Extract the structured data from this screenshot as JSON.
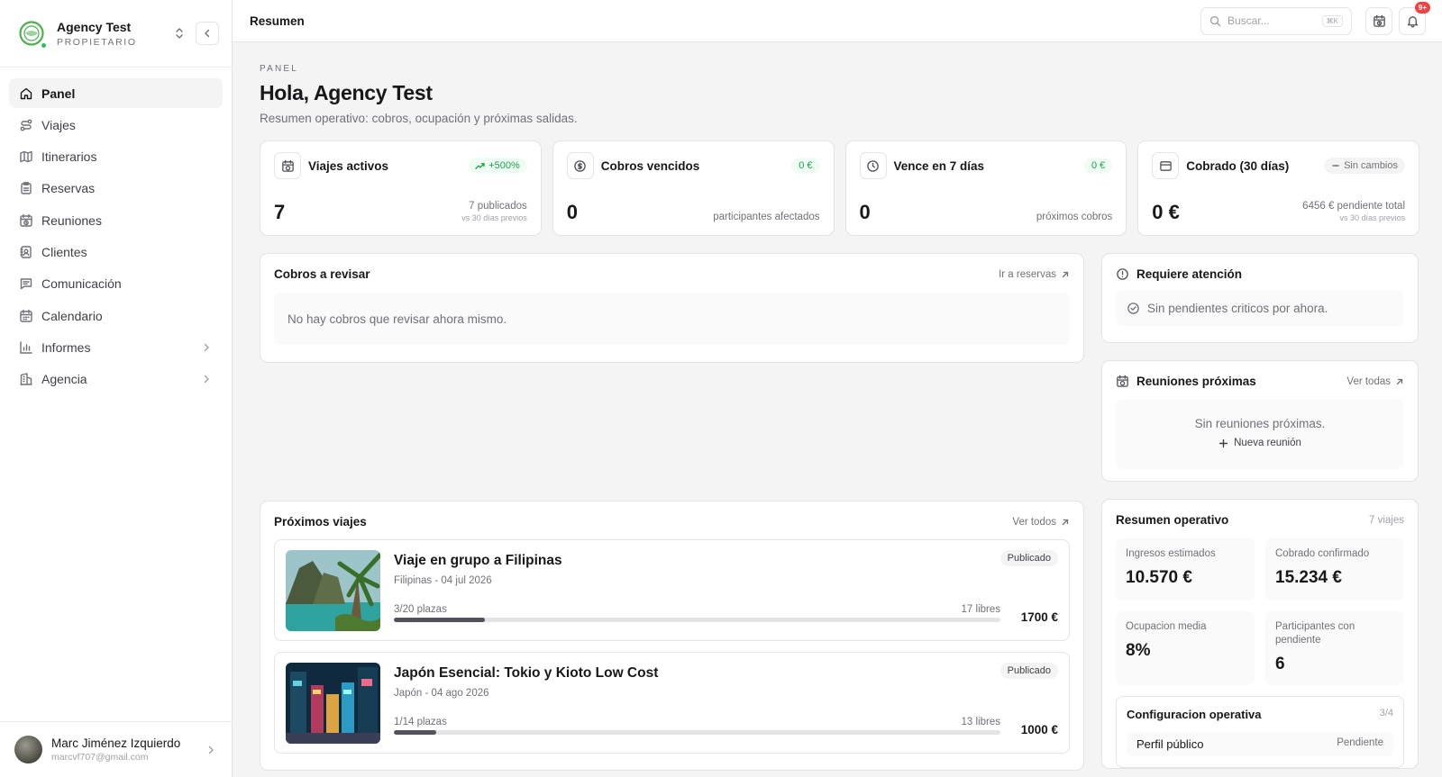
{
  "sidebar": {
    "agency_name": "Agency Test",
    "agency_role": "PROPIETARIO",
    "items": [
      {
        "label": "Panel",
        "icon": "home-icon"
      },
      {
        "label": "Viajes",
        "icon": "route-icon"
      },
      {
        "label": "Itinerarios",
        "icon": "map-icon"
      },
      {
        "label": "Reservas",
        "icon": "clipboard-icon"
      },
      {
        "label": "Reuniones",
        "icon": "calendar-clock-icon"
      },
      {
        "label": "Clientes",
        "icon": "contacts-icon"
      },
      {
        "label": "Comunicación",
        "icon": "message-icon"
      },
      {
        "label": "Calendario",
        "icon": "calendar-icon"
      },
      {
        "label": "Informes",
        "icon": "bar-chart-icon"
      },
      {
        "label": "Agencia",
        "icon": "building-icon"
      }
    ],
    "user": {
      "name": "Marc Jiménez Izquierdo",
      "email": "marcvf707@gmail.com"
    }
  },
  "topbar": {
    "title": "Resumen",
    "search_placeholder": "Buscar...",
    "search_shortcut": "⌘K",
    "notification_count": "9+"
  },
  "header": {
    "eyebrow": "PANEL",
    "greeting": "Hola, Agency Test",
    "subtitle": "Resumen operativo: cobros, ocupación y próximas salidas."
  },
  "stats": [
    {
      "title": "Viajes activos",
      "pill": "+500%",
      "value": "7",
      "note": "7 publicados",
      "note2": "vs 30 días previos"
    },
    {
      "title": "Cobros vencidos",
      "pill": "0 €",
      "value": "0",
      "note": "participantes afectados",
      "note2": ""
    },
    {
      "title": "Vence en 7 días",
      "pill": "0 €",
      "value": "0",
      "note": "próximos cobros",
      "note2": ""
    },
    {
      "title": "Cobrado (30 días)",
      "pill": "Sin cambios",
      "value": "0 €",
      "note": "6456 € pendiente total",
      "note2": "vs 30 días previos"
    }
  ],
  "cobros": {
    "title": "Cobros a revisar",
    "link": "Ir a reservas",
    "empty": "No hay cobros que revisar ahora mismo."
  },
  "atencion": {
    "title": "Requiere atención",
    "message": "Sin pendientes criticos por ahora."
  },
  "reuniones": {
    "title": "Reuniones próximas",
    "link": "Ver todas",
    "empty": "Sin reuniones próximas.",
    "new_label": "Nueva reunión"
  },
  "viajes": {
    "title": "Próximos viajes",
    "link": "Ver todos",
    "items": [
      {
        "title": "Viaje en grupo a Filipinas",
        "subtitle": "Filipinas - 04 jul 2026",
        "status": "Publicado",
        "plazas": "3/20 plazas",
        "libres": "17 libres",
        "price": "1700 €",
        "occupancy": 0.15
      },
      {
        "title": "Japón Esencial: Tokio y Kioto Low Cost",
        "subtitle": "Japón - 04 ago 2026",
        "status": "Publicado",
        "plazas": "1/14 plazas",
        "libres": "13 libres",
        "price": "1000 €",
        "occupancy": 0.07
      }
    ]
  },
  "resumen": {
    "title": "Resumen operativo",
    "count": "7 viajes",
    "metrics": [
      {
        "label": "Ingresos estimados",
        "value": "10.570 €"
      },
      {
        "label": "Cobrado confirmado",
        "value": "15.234 €"
      },
      {
        "label": "Ocupacion media",
        "value": "8%"
      },
      {
        "label": "Participantes con pendiente",
        "value": "6"
      }
    ],
    "config": {
      "title": "Configuracion operativa",
      "count": "3/4",
      "row_label": "Perfil público",
      "row_status": "Pendiente"
    }
  },
  "colors": {
    "accent": "#16a34a",
    "badge": "#ef4444",
    "online": "#22c55e"
  }
}
